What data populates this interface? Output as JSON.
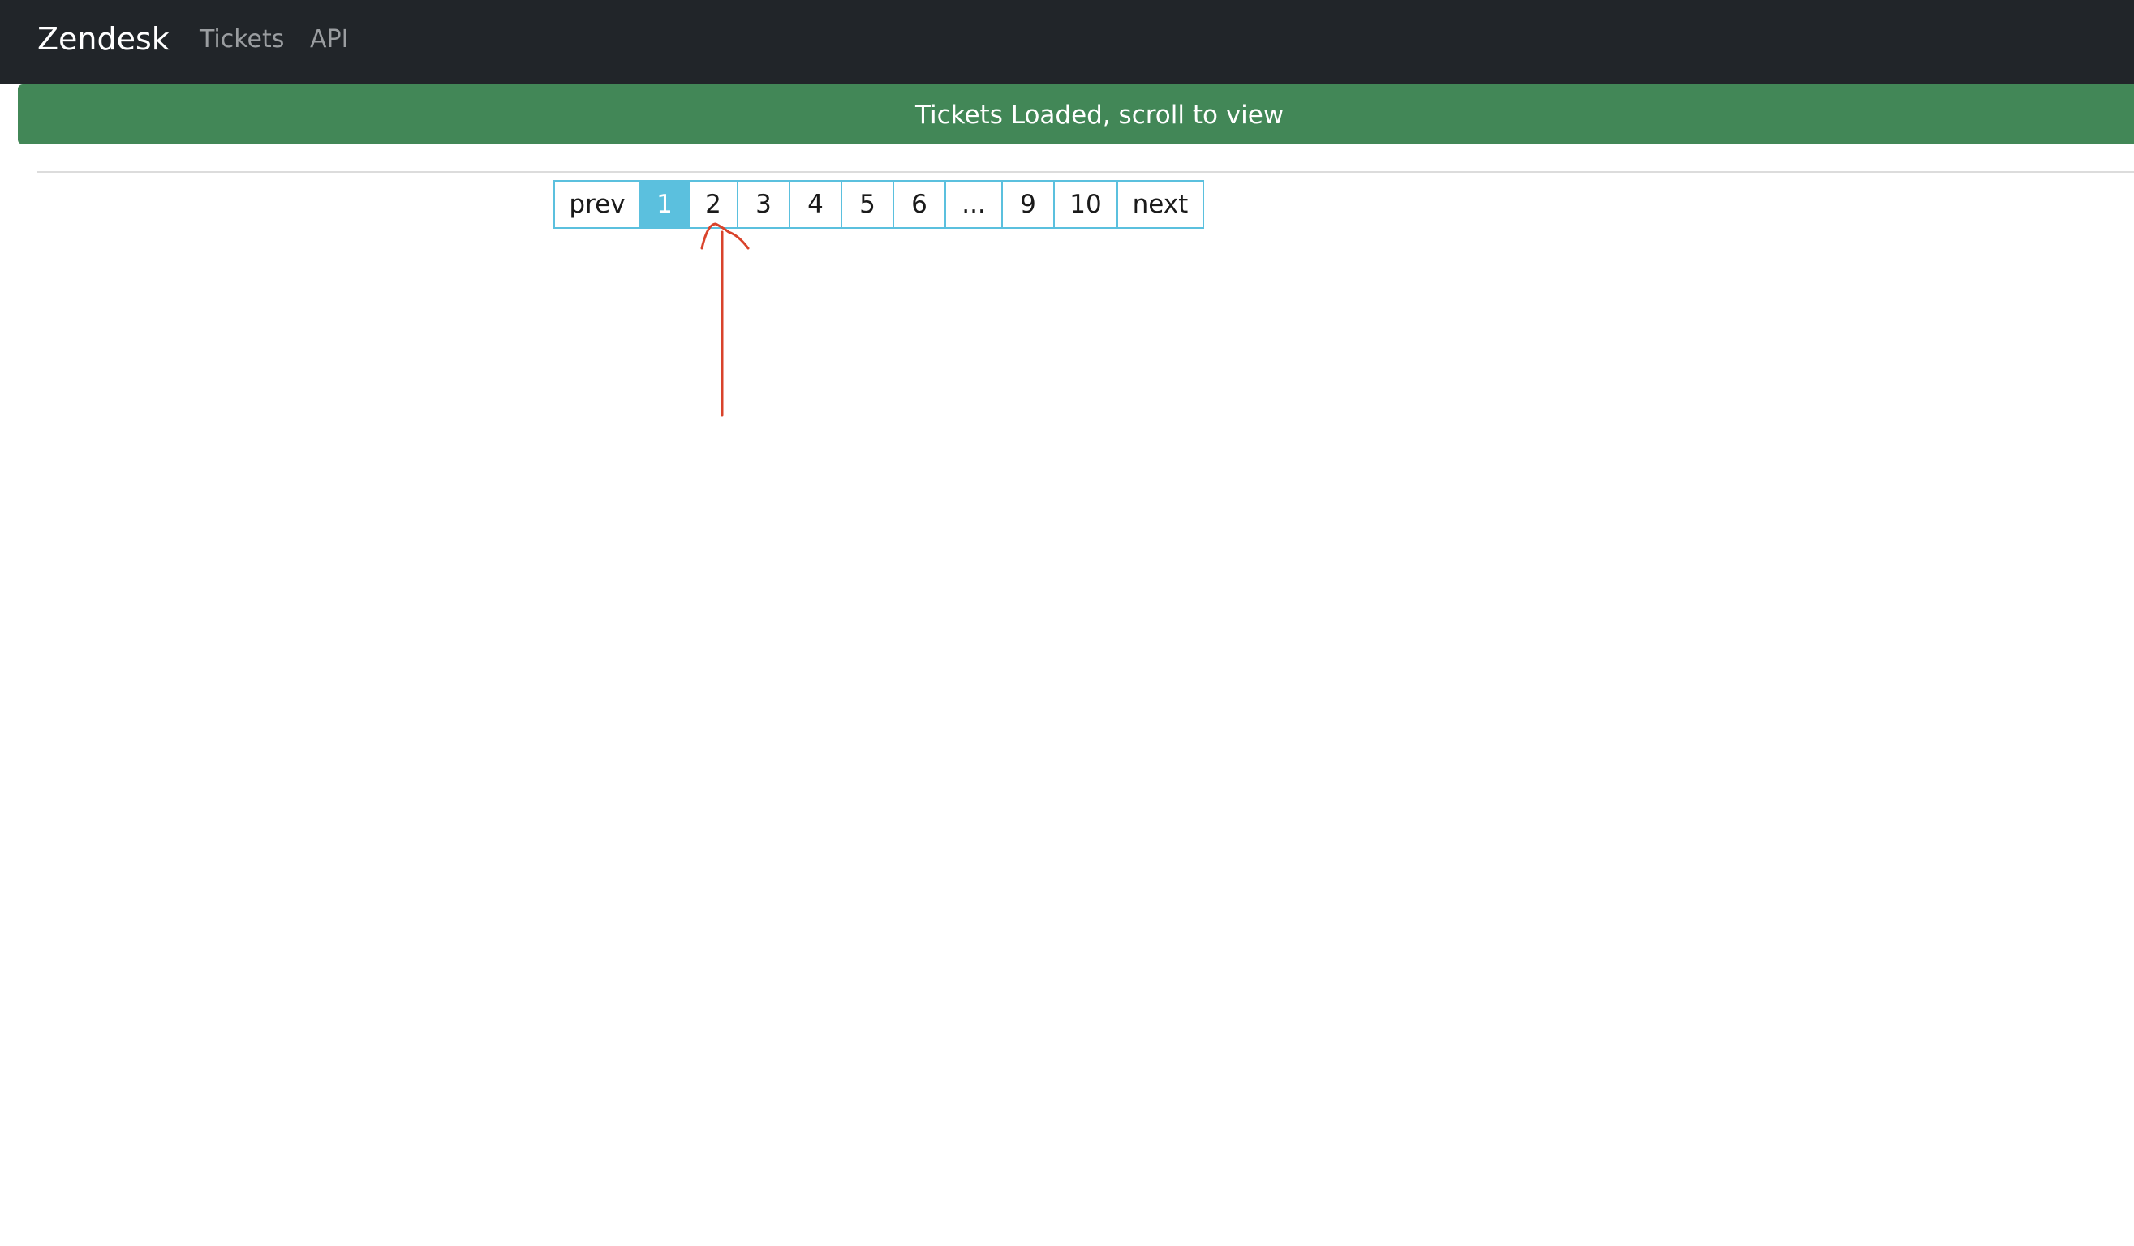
{
  "navbar": {
    "brand": "Zendesk",
    "links": [
      {
        "label": "Tickets"
      },
      {
        "label": "API"
      }
    ]
  },
  "alert": {
    "message": "Tickets Loaded, scroll to view",
    "color": "#428757"
  },
  "pagination": {
    "prev_label": "prev",
    "next_label": "next",
    "pages": [
      "1",
      "2",
      "3",
      "4",
      "5",
      "6",
      "...",
      "9",
      "10"
    ],
    "current_page": "1",
    "accent_color": "#5bc0de"
  },
  "annotation": {
    "type": "hand-drawn arrow",
    "target": "page 2",
    "color": "#d9432b"
  }
}
